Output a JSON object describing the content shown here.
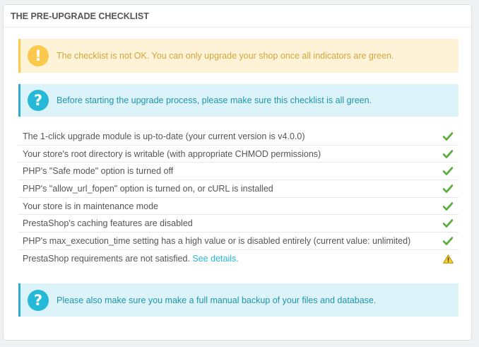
{
  "panel": {
    "title": "The pre-upgrade checklist"
  },
  "alerts": {
    "warning": {
      "icon": "exclamation-icon",
      "text": "The checklist is not OK. You can only upgrade your shop once all indicators are green."
    },
    "info_top": {
      "icon": "question-icon",
      "text": "Before starting the upgrade process, please make sure this checklist is all green."
    },
    "info_bottom": {
      "icon": "question-icon",
      "text": "Please also make sure you make a full manual backup of your files and database."
    }
  },
  "checklist": [
    {
      "text": "The 1-click upgrade module is up-to-date (your current version is v4.0.0)",
      "status": "ok"
    },
    {
      "text": "Your store's root directory is writable (with appropriate CHMOD permissions)",
      "status": "ok"
    },
    {
      "text": "PHP's \"Safe mode\" option is turned off",
      "status": "ok"
    },
    {
      "text": "PHP's \"allow_url_fopen\" option is turned on, or cURL is installed",
      "status": "ok"
    },
    {
      "text": "Your store is in maintenance mode",
      "status": "ok"
    },
    {
      "text": "PrestaShop's caching features are disabled",
      "status": "ok"
    },
    {
      "text": "PHP's max_execution_time setting has a high value or is disabled entirely (current value: unlimited)",
      "status": "ok"
    },
    {
      "text": "PrestaShop requirements are not satisfied.",
      "status": "warning",
      "link": "See details."
    }
  ],
  "colors": {
    "ok": "#5cae40",
    "warning_fill": "#f6d32d",
    "warning_stroke": "#b88a00",
    "link": "#25b9d7"
  }
}
